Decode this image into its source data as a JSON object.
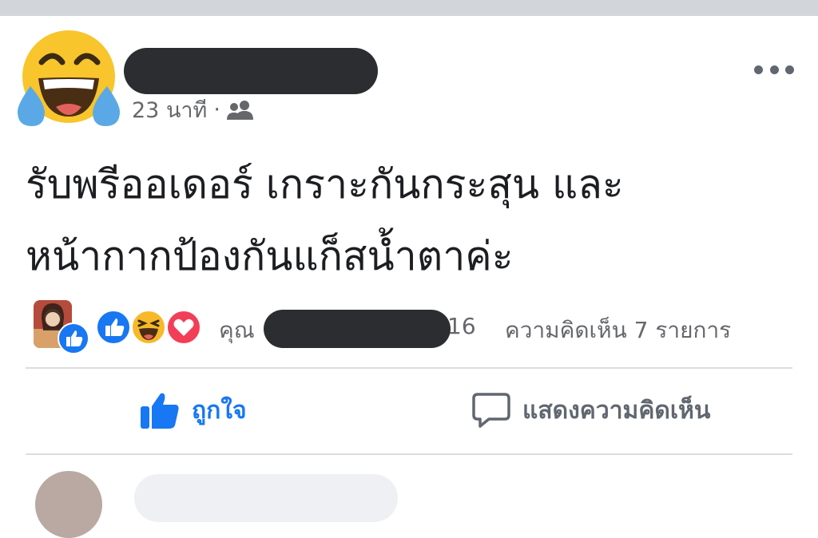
{
  "post": {
    "time": "23 นาที",
    "separator": "·",
    "privacy_icon": "friends-icon",
    "line1": "รับพรีออเดอร์ เกราะกันกระสุน และ",
    "line2": "หน้ากากป้องกันแก็สน้ำตาค่ะ",
    "menu_icon": "more-horizontal-icon"
  },
  "reactions": {
    "types": [
      "like",
      "haha",
      "love"
    ],
    "prefix": "คุณ",
    "count_suffix": "16",
    "comments": "ความคิดเห็น 7 รายการ"
  },
  "actions": {
    "like": "ถูกใจ",
    "comment": "แสดงความคิดเห็น"
  },
  "colors": {
    "like_blue": "#1877f2",
    "love_red": "#f33e58",
    "haha_yellow": "#f7b928",
    "secondary_text": "#65676b",
    "redaction": "#2b2d31"
  }
}
